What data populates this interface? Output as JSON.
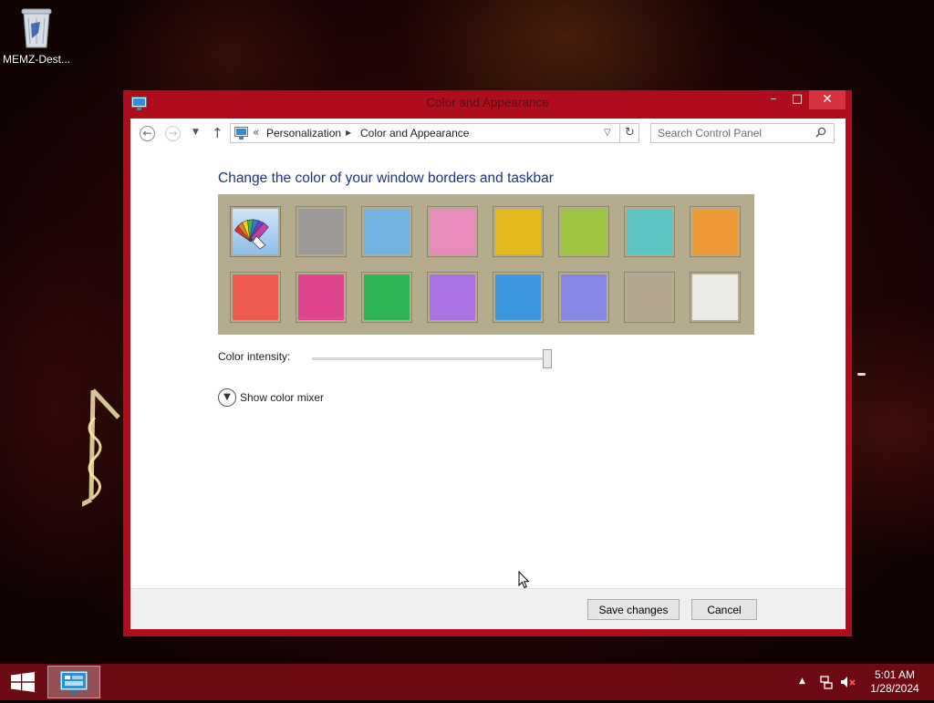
{
  "desktop": {
    "icons": [
      {
        "label": "MEMZ-Dest...",
        "icon": "recycle-bin-icon"
      }
    ]
  },
  "window": {
    "title": "Color and Appearance",
    "title_color": "#5a0a14",
    "frame_color": "#b00d1c",
    "caption_buttons": {
      "minimize": "–",
      "maximize": "□",
      "close": "✕"
    },
    "nav": {
      "back_icon": "back-arrow-icon",
      "forward_icon": "forward-arrow-icon",
      "recent_icon": "dropdown-icon",
      "up_icon": "up-arrow-icon",
      "address": {
        "overflow": "«",
        "breadcrumbs": [
          "Personalization",
          "Color and Appearance"
        ]
      },
      "search": {
        "placeholder": "Search Control Panel",
        "value": ""
      }
    },
    "content": {
      "heading": "Change the color of your window borders and taskbar",
      "palette_background": "#b5ac8e",
      "swatches": [
        {
          "color": "auto",
          "icon": "color-fan-icon",
          "selected": true
        },
        {
          "color": "#9d9996"
        },
        {
          "color": "#72b3e2"
        },
        {
          "color": "#e88cbc"
        },
        {
          "color": "#e2ba20"
        },
        {
          "color": "#9ec640"
        },
        {
          "color": "#5ec6c2"
        },
        {
          "color": "#ee9a36"
        },
        {
          "color": "#ec5a52"
        },
        {
          "color": "#e0448e"
        },
        {
          "color": "#2eb452"
        },
        {
          "color": "#aa72e0"
        },
        {
          "color": "#3c96e0"
        },
        {
          "color": "#8686e4"
        },
        {
          "color": "#b3a692"
        },
        {
          "color": "#ebe9e3"
        }
      ],
      "intensity_label": "Color intensity:",
      "intensity_value": 1.0,
      "mixer_label": "Show color mixer"
    },
    "footer": {
      "save": "Save changes",
      "cancel": "Cancel"
    }
  },
  "taskbar": {
    "color": "#6e0a14",
    "clock_time": "5:01 AM",
    "clock_date": "1/28/2024",
    "tray_icons": [
      "show-hidden-icons-icon",
      "network-icon",
      "volume-muted-icon"
    ]
  }
}
